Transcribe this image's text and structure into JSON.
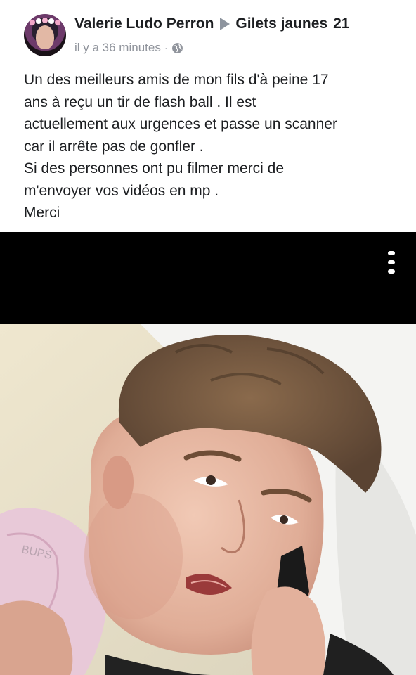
{
  "post": {
    "author": "Valerie Ludo Perron",
    "group": "Gilets jaunes",
    "group_number": "21",
    "timestamp": "il y a 36 minutes",
    "separator": "·",
    "privacy_icon": "globe-icon",
    "body_lines": [
      "Un des meilleurs amis de mon fils d'à peine 17",
      "ans à reçu un tir de flash ball . Il est",
      "actuellement aux urgences et passe un scanner",
      "car il arrête pas de gonfler .",
      "Si des personnes ont pu filmer merci de",
      "m'envoyer vos vidéos en mp .",
      "Merci"
    ]
  },
  "media": {
    "menu_icon": "more-vertical-icon",
    "photo_description_icon": "photo-image",
    "pillow_text": "BUPS"
  },
  "colors": {
    "text": "#1c1e21",
    "meta": "#90949c",
    "video_bar": "#000000"
  }
}
